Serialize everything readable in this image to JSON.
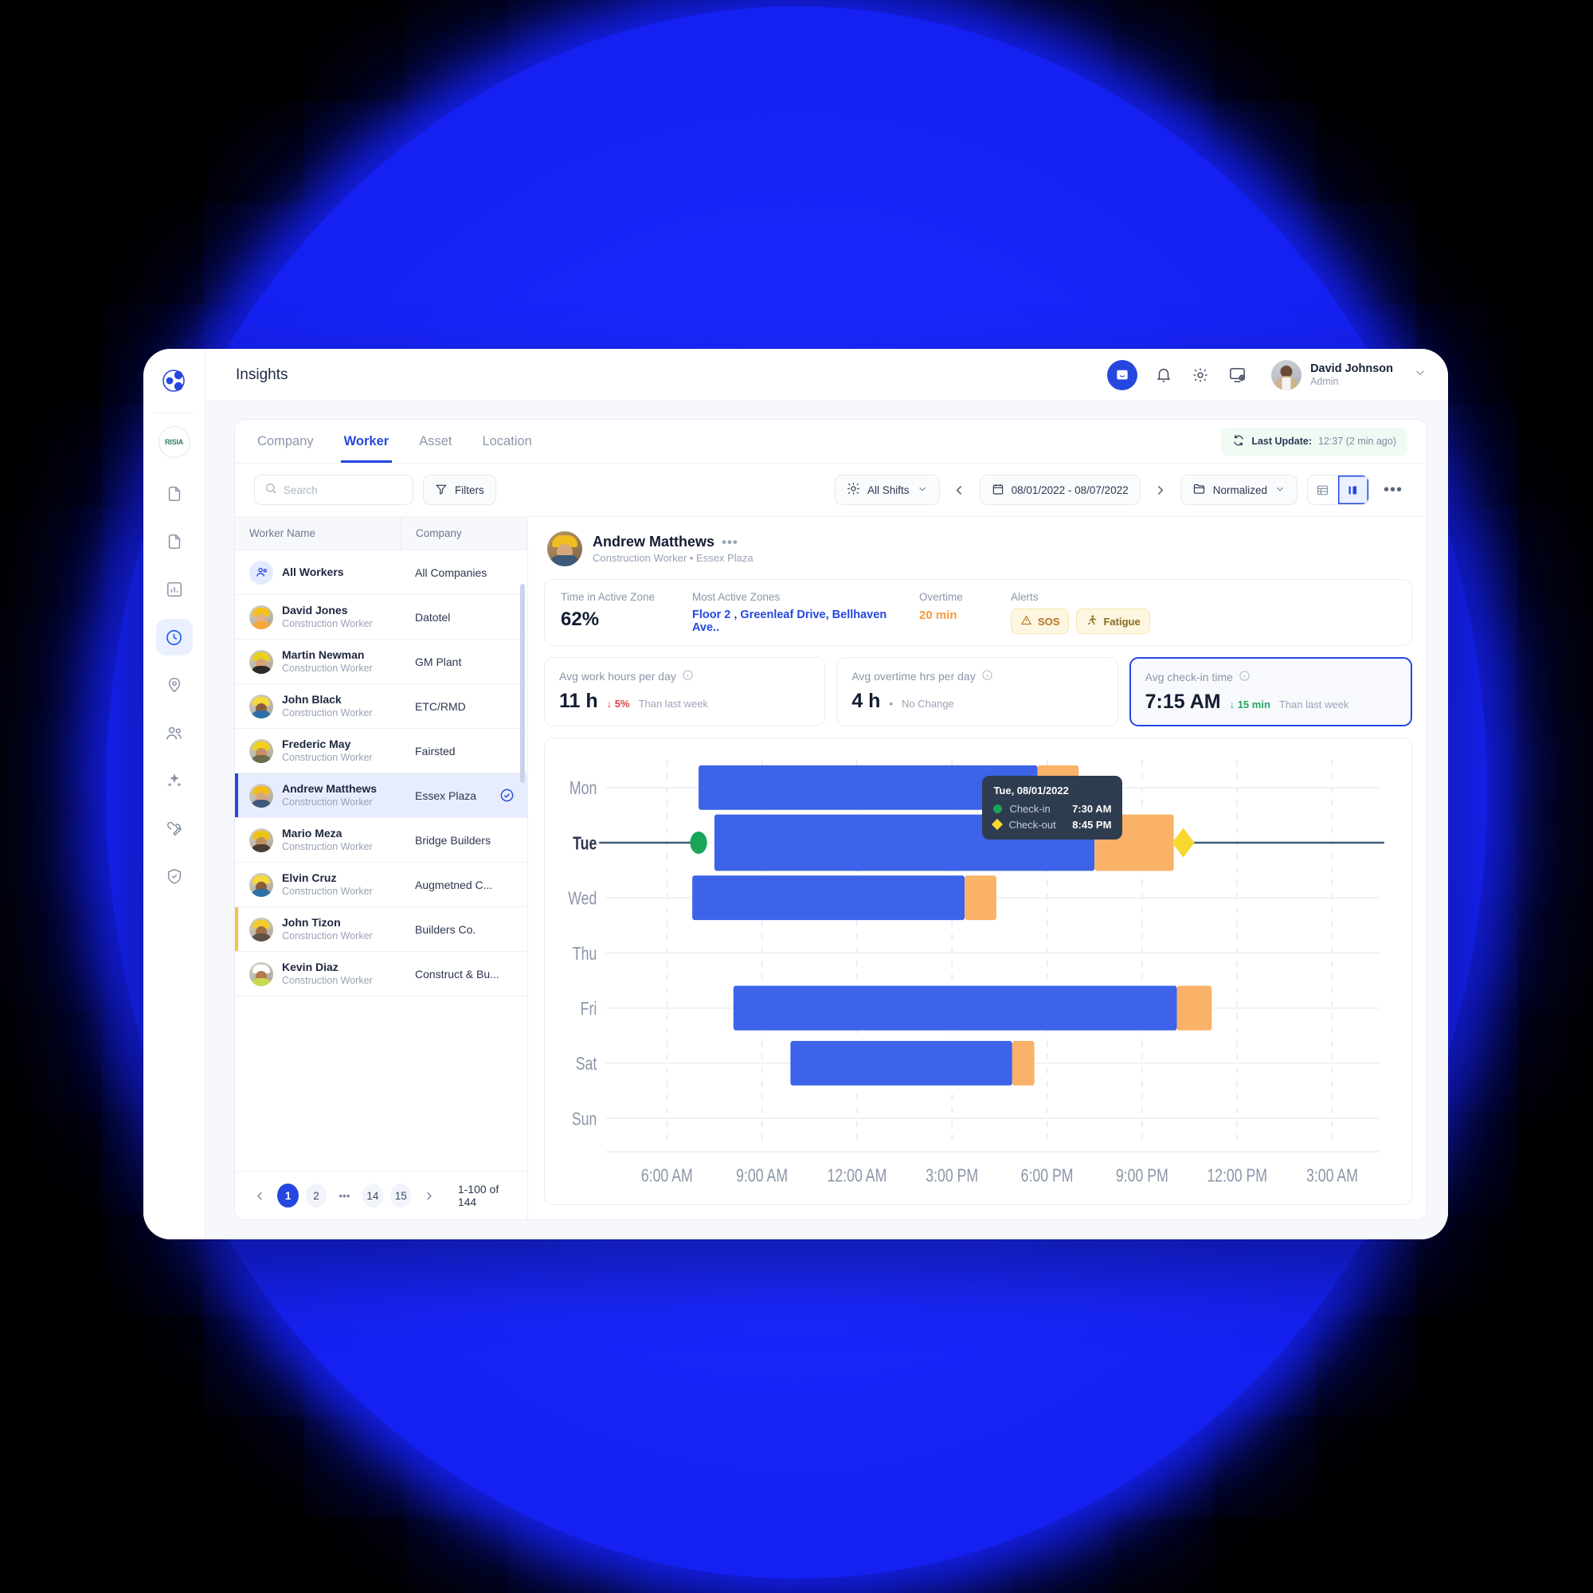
{
  "brand": {
    "logo_icon": "molecule-logo-icon",
    "badge_text": "RISIA"
  },
  "rail": {
    "items": [
      {
        "icon": "document-icon",
        "name": "sidebar-item-documents",
        "active": false
      },
      {
        "icon": "document-icon",
        "name": "sidebar-item-reports",
        "active": false
      },
      {
        "icon": "bar-chart-icon",
        "name": "sidebar-item-analytics",
        "active": false
      },
      {
        "icon": "clock-icon",
        "name": "sidebar-item-insights",
        "active": true
      },
      {
        "icon": "map-pin-icon",
        "name": "sidebar-item-locations",
        "active": false
      },
      {
        "icon": "people-icon",
        "name": "sidebar-item-workers",
        "active": false
      },
      {
        "icon": "sparkle-icon",
        "name": "sidebar-item-assets",
        "active": false
      },
      {
        "icon": "wrench-icon",
        "name": "sidebar-item-maintenance",
        "active": false
      },
      {
        "icon": "shield-icon",
        "name": "sidebar-item-safety",
        "active": false
      }
    ]
  },
  "topbar": {
    "title": "Insights",
    "chat_icon": "chat-bubble-icon",
    "bell_icon": "bell-icon",
    "gear_icon": "gear-icon",
    "screen_settings_icon": "screen-settings-icon",
    "user": {
      "name": "David Johnson",
      "role": "Admin",
      "caret_icon": "chevron-down-icon"
    }
  },
  "tabs": [
    {
      "label": "Company",
      "active": false
    },
    {
      "label": "Worker",
      "active": true
    },
    {
      "label": "Asset",
      "active": false
    },
    {
      "label": "Location",
      "active": false
    }
  ],
  "last_update": {
    "icon": "refresh-icon",
    "label": "Last Update:",
    "value": "12:37 (2 min ago)"
  },
  "toolbar": {
    "search_placeholder": "Search",
    "search_value": "",
    "search_icon": "search-icon",
    "filters_label": "Filters",
    "filters_icon": "funnel-icon",
    "shift_label": "All Shifts",
    "shift_icon": "sun-icon",
    "prev_icon": "chevron-left-icon",
    "next_icon": "chevron-right-icon",
    "date_range": "08/01/2022 - 08/07/2022",
    "calendar_icon": "calendar-icon",
    "view_mode": "Normalized",
    "view_mode_icon": "folder-icon",
    "table_view_icon": "table-view-icon",
    "column_view_icon": "column-view-icon",
    "more_icon": "more-horizontal-icon"
  },
  "list": {
    "columns": [
      "Worker Name",
      "Company"
    ],
    "rows": [
      {
        "name": "All Workers",
        "role": "",
        "company": "All Companies",
        "state": "all",
        "checked": false
      },
      {
        "name": "David Jones",
        "role": "Construction Worker",
        "company": "Datotel",
        "state": "",
        "checked": false
      },
      {
        "name": "Martin Newman",
        "role": "Construction Worker",
        "company": "GM Plant",
        "state": "",
        "checked": false
      },
      {
        "name": "John Black",
        "role": "Construction Worker",
        "company": "ETC/RMD",
        "state": "",
        "checked": false
      },
      {
        "name": "Frederic May",
        "role": "Construction Worker",
        "company": "Fairsted",
        "state": "",
        "checked": false
      },
      {
        "name": "Andrew Matthews",
        "role": "Construction Worker",
        "company": "Essex Plaza",
        "state": "selected",
        "checked": true
      },
      {
        "name": "Mario Meza",
        "role": "Construction Worker",
        "company": "Bridge Builders",
        "state": "",
        "checked": false
      },
      {
        "name": "Elvin Cruz",
        "role": "Construction Worker",
        "company": "Augmetned C...",
        "state": "",
        "checked": false
      },
      {
        "name": "John Tizon",
        "role": "Construction Worker",
        "company": "Builders Co.",
        "state": "warn",
        "checked": false
      },
      {
        "name": "Kevin Diaz",
        "role": "Construction Worker",
        "company": "Construct & Bu...",
        "state": "",
        "checked": false
      }
    ]
  },
  "pagination": {
    "prev_icon": "chevron-left-icon",
    "next_icon": "chevron-right-icon",
    "pages": [
      "1",
      "2",
      "•••",
      "14",
      "15"
    ],
    "current": "1",
    "summary": "1-100 of 144"
  },
  "detail": {
    "name": "Andrew Matthews",
    "menu_icon": "more-horizontal-icon",
    "subtitle": "Construction Worker  •  Essex Plaza",
    "stats": [
      {
        "label": "Time in Active Zone",
        "value": "62%",
        "kind": "big"
      },
      {
        "label": "Most Active Zones",
        "value": "Floor 2 , Greenleaf Drive, Bellhaven Ave..",
        "kind": "link"
      },
      {
        "label": "Overtime",
        "value": "20 min",
        "kind": "orange"
      }
    ],
    "alerts_label": "Alerts",
    "alerts": [
      {
        "label": "SOS",
        "icon": "warning-triangle-icon"
      },
      {
        "label": "Fatigue",
        "icon": "running-person-icon"
      }
    ],
    "metrics": [
      {
        "label": "Avg work hours per day",
        "info_icon": "info-icon",
        "value": "11 h",
        "delta": "↓ 5%",
        "delta_kind": "down-bad",
        "note": "Than last week",
        "highlight": false
      },
      {
        "label": "Avg overtime hrs per day",
        "info_icon": "info-icon",
        "value": "4 h",
        "delta": "•",
        "delta_kind": "flat",
        "note": "No Change",
        "highlight": false
      },
      {
        "label": "Avg check-in time",
        "info_icon": "info-icon",
        "value": "7:15 AM",
        "delta": "↓ 15 min",
        "delta_kind": "good",
        "note": "Than last week",
        "highlight": true
      }
    ]
  },
  "chart_data": {
    "type": "bar",
    "orientation": "horizontal",
    "title": "",
    "xlabel": "",
    "ylabel": "",
    "categories": [
      "Mon",
      "Tue",
      "Wed",
      "Thu",
      "Fri",
      "Sat",
      "Sun"
    ],
    "x_tick_labels": [
      "6:00 AM",
      "9:00 AM",
      "12:00 AM",
      "3:00 PM",
      "6:00 PM",
      "9:00 PM",
      "12:00 PM",
      "3:00 AM"
    ],
    "x_axis_hours": [
      6,
      9,
      12,
      15,
      18,
      21,
      24,
      27
    ],
    "xlim": [
      4.5,
      28.5
    ],
    "grid": true,
    "series": [
      {
        "name": "Work",
        "color": "#3c63e8"
      },
      {
        "name": "Overtime",
        "color": "#f9b267"
      }
    ],
    "bars": [
      {
        "day": "Mon",
        "work_start": 7.0,
        "work_end": 17.7,
        "overtime_end": 19.0
      },
      {
        "day": "Tue",
        "work_start": 7.5,
        "work_end": 19.5,
        "overtime_end": 22.0
      },
      {
        "day": "Wed",
        "work_start": 6.8,
        "work_end": 15.4,
        "overtime_end": 16.4
      },
      {
        "day": "Thu",
        "work_start": null,
        "work_end": null,
        "overtime_end": null
      },
      {
        "day": "Fri",
        "work_start": 8.1,
        "work_end": 22.1,
        "overtime_end": 23.2
      },
      {
        "day": "Sat",
        "work_start": 9.9,
        "work_end": 16.9,
        "overtime_end": 17.6
      },
      {
        "day": "Sun",
        "work_start": null,
        "work_end": null,
        "overtime_end": null
      }
    ],
    "markers": [
      {
        "day": "Tue",
        "type": "check-in",
        "hour": 7.0,
        "shape": "circle",
        "color": "#18a558"
      },
      {
        "day": "Tue",
        "type": "check-out",
        "hour": 22.3,
        "shape": "diamond",
        "color": "#f7d92e"
      }
    ],
    "highlight_day": "Tue"
  },
  "tooltip": {
    "title": "Tue, 08/01/2022",
    "rows": [
      {
        "marker": "circle-green-icon",
        "label": "Check-in",
        "value": "7:30 AM"
      },
      {
        "marker": "diamond-yellow-icon",
        "label": "Check-out",
        "value": "8:45 PM"
      }
    ]
  }
}
